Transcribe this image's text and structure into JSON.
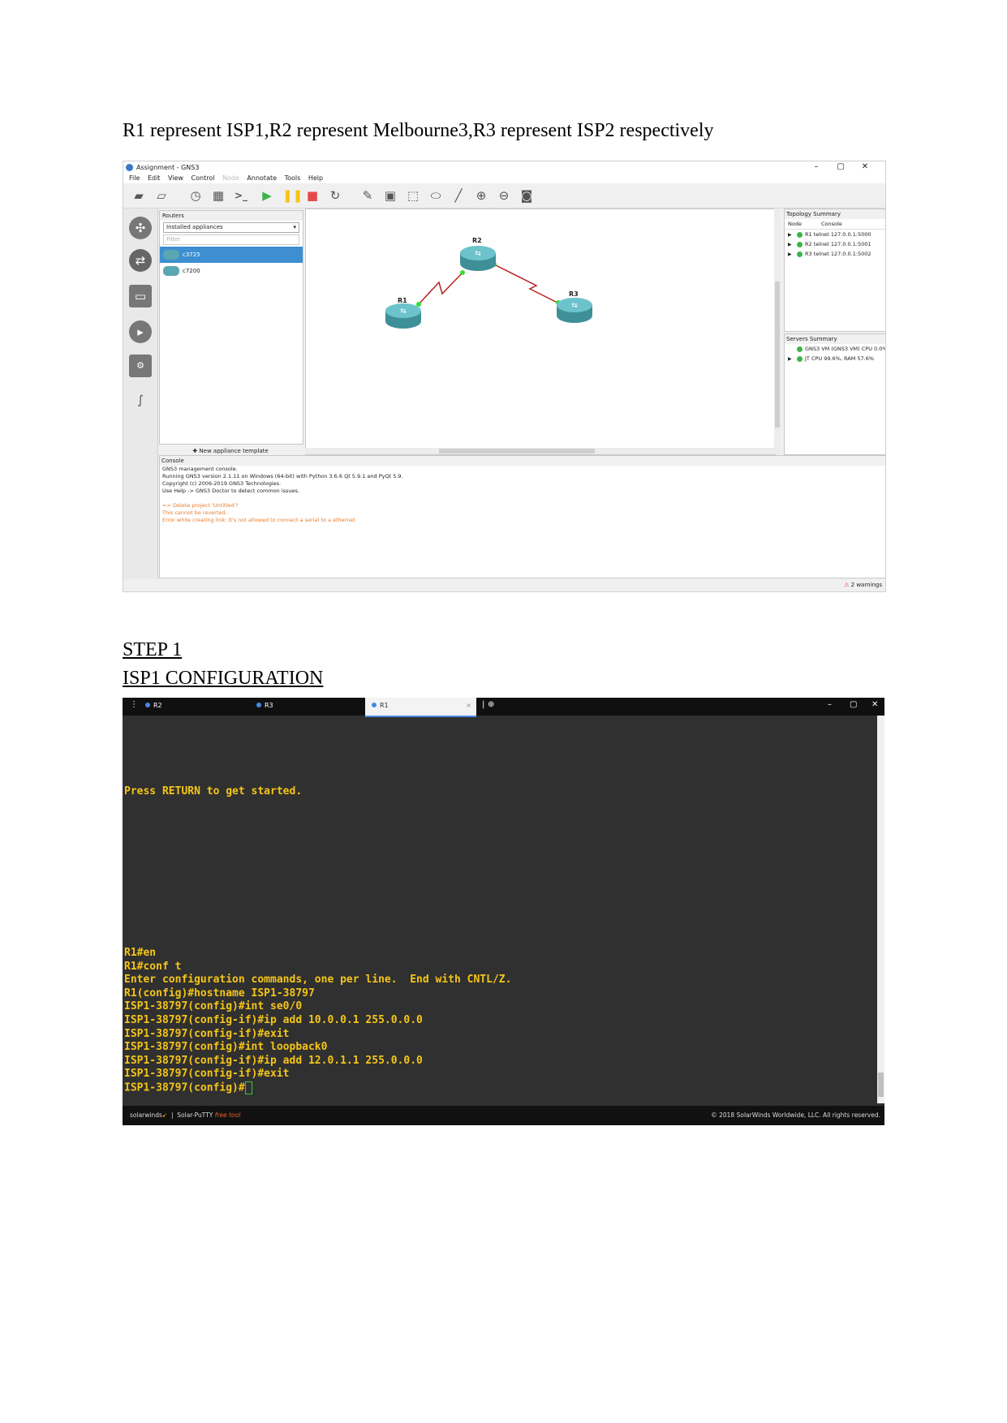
{
  "intro_text": "R1 represent ISP1,R2 represent Melbourne3,R3 represent ISP2 respectively",
  "gns3": {
    "window_title": "Assignment - GNS3",
    "window_controls": [
      "–",
      "▢",
      "✕"
    ],
    "menu": [
      "File",
      "Edit",
      "View",
      "Control",
      "Node",
      "Annotate",
      "Tools",
      "Help"
    ],
    "routers_panel": {
      "title": "Routers",
      "dropdown": "Installed appliances",
      "filter_placeholder": "Filter",
      "items": [
        "c3725",
        "c7200"
      ],
      "new_template": "New appliance template"
    },
    "nodes": [
      "R1",
      "R2",
      "R3"
    ],
    "topology_summary": {
      "title": "Topology Summary",
      "columns": [
        "Node",
        "Console"
      ],
      "rows": [
        {
          "node": "R1",
          "console": "telnet 127.0.0.1:5000"
        },
        {
          "node": "R2",
          "console": "telnet 127.0.0.1:5001"
        },
        {
          "node": "R3",
          "console": "telnet 127.0.0.1:5002"
        }
      ]
    },
    "servers_summary": {
      "title": "Servers Summary",
      "rows": [
        "GNS3 VM (GNS3 VM) CPU 0.0%, RA...",
        "JT CPU 99.6%, RAM 57.6%"
      ]
    },
    "console": {
      "title": "Console",
      "lines": [
        "GNS3 management console.",
        "Running GNS3 version 2.1.11 on Windows (64-bit) with Python 3.6.6 Qt 5.9.1 and PyQt 5.9.",
        "Copyright (c) 2006-2019 GNS3 Technologies.",
        "Use Help -> GNS3 Doctor to detect common issues."
      ],
      "warnings": [
        "=> Delete project 'Untitled'?",
        "This cannot be reverted.",
        "Error while creating link: It's not allowed to connect a serial to a ethernet"
      ]
    },
    "status_warnings": "2 warnings"
  },
  "step_heading": "STEP 1 ",
  "section_heading": "ISP1 CONFIGURATION",
  "terminal": {
    "tabs": [
      "R2",
      "R3",
      "R1"
    ],
    "tab_close": "×",
    "window_controls": [
      "–",
      "▢",
      "✕"
    ],
    "press_return": "Press RETURN to get started.",
    "lines": [
      "R1#en",
      "R1#conf t",
      "Enter configuration commands, one per line.  End with CNTL/Z.",
      "R1(config)#hostname ISP1-38797",
      "ISP1-38797(config)#int se0/0",
      "ISP1-38797(config-if)#ip add 10.0.0.1 255.0.0.0",
      "ISP1-38797(config-if)#exit",
      "ISP1-38797(config)#int loopback0",
      "ISP1-38797(config-if)#ip add 12.0.1.1 255.0.0.0",
      "ISP1-38797(config-if)#exit",
      "ISP1-38797(config)#"
    ],
    "footer_brand": "solarwinds",
    "footer_product": "Solar-PuTTY",
    "footer_free": "free tool",
    "footer_copyright": "© 2018 SolarWinds Worldwide, LLC. All rights reserved."
  }
}
